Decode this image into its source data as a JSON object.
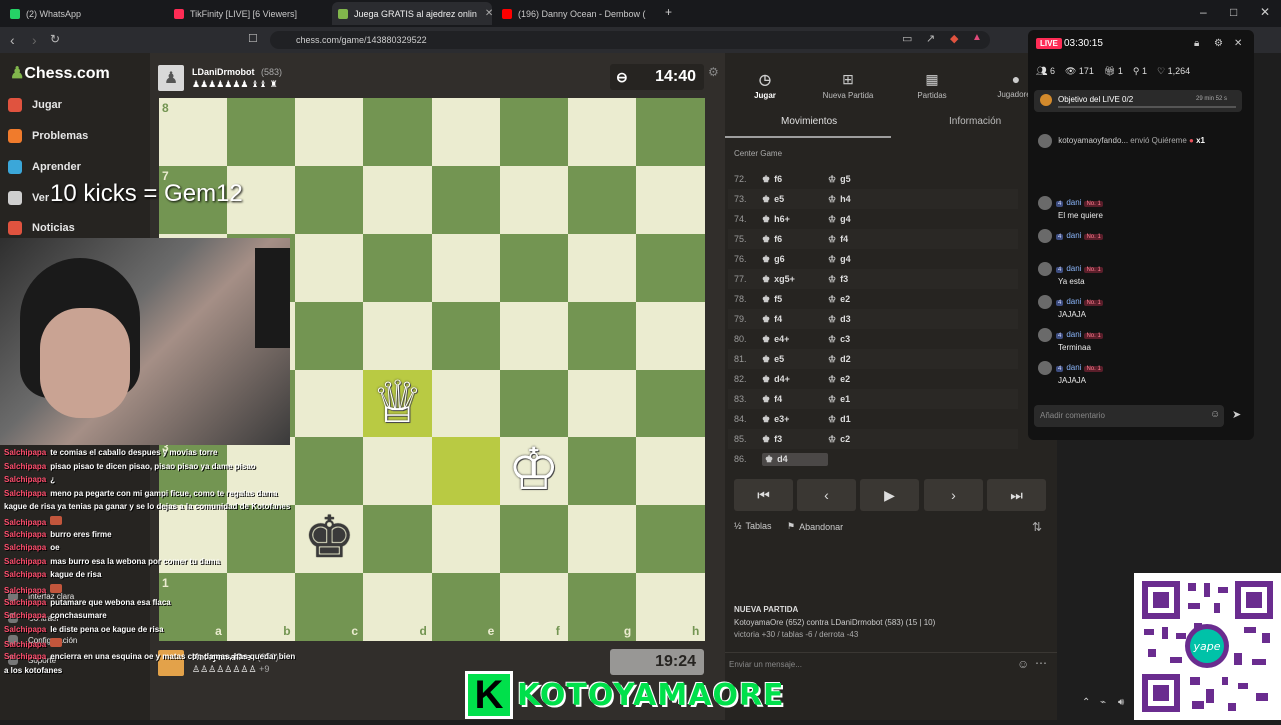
{
  "browser": {
    "tabs": [
      {
        "label": "(2) WhatsApp",
        "color": "#25d366"
      },
      {
        "label": "TikFinity [LIVE] [6 Viewers]",
        "color": "#fe2c55"
      },
      {
        "label": "Juega GRATIS al ajedrez onlin",
        "color": "#81b64c"
      },
      {
        "label": "(196) Danny Ocean - Dembow (",
        "color": "#ff0000"
      }
    ],
    "url": "chess.com/game/143880329522"
  },
  "sidebar": {
    "logo": "Chess.com",
    "items": [
      {
        "label": "Jugar",
        "icon": "play-icon",
        "color": "#e0533f"
      },
      {
        "label": "Problemas",
        "icon": "puzzle-icon",
        "color": "#f07b2c"
      },
      {
        "label": "Aprender",
        "icon": "learn-icon",
        "color": "#3ba7d9"
      },
      {
        "label": "Ver",
        "icon": "binoculars-icon",
        "color": "#cfcfcf"
      },
      {
        "label": "Noticias",
        "icon": "news-icon",
        "color": "#e0533f"
      }
    ],
    "bottom": [
      "Interfaz clara",
      "Contraer",
      "Configuración",
      "Soporte"
    ]
  },
  "overlay": {
    "kicks": "10 kicks = Gem12",
    "brand_letter": "K",
    "brand_name": "KOTOYAMAORE"
  },
  "game": {
    "top_player": {
      "name": "LDaniDrmobot",
      "rating": "(583)",
      "clock": "14:40"
    },
    "bottom_player": {
      "name": "KotoyamaOre",
      "rating": "(652)",
      "clock": "19:24",
      "captures_extra": "+9"
    },
    "files": [
      "a",
      "b",
      "c",
      "d",
      "e",
      "f",
      "g",
      "h"
    ],
    "ranks_shown": [
      "8",
      "7",
      "3",
      "1"
    ]
  },
  "panel": {
    "tabs": [
      {
        "label": "Jugar",
        "icon": "clock-icon"
      },
      {
        "label": "Nueva Partida",
        "icon": "plus-icon"
      },
      {
        "label": "Partidas",
        "icon": "board-icon"
      },
      {
        "label": "Jugadores",
        "icon": "players-icon"
      }
    ],
    "subtabs": [
      "Movimientos",
      "Información"
    ],
    "opening": "Center Game",
    "moves": [
      {
        "n": "72.",
        "w": "f6",
        "b": "g5"
      },
      {
        "n": "73.",
        "w": "e5",
        "b": "h4"
      },
      {
        "n": "74.",
        "w": "h6+",
        "b": "g4"
      },
      {
        "n": "75.",
        "w": "f6",
        "b": "f4"
      },
      {
        "n": "76.",
        "w": "g6",
        "b": "g4"
      },
      {
        "n": "77.",
        "w": "xg5+",
        "b": "f3"
      },
      {
        "n": "78.",
        "w": "f5",
        "b": "e2"
      },
      {
        "n": "79.",
        "w": "f4",
        "b": "d3"
      },
      {
        "n": "80.",
        "w": "e4+",
        "b": "c3"
      },
      {
        "n": "81.",
        "w": "e5",
        "b": "d2"
      },
      {
        "n": "82.",
        "w": "d4+",
        "b": "e2"
      },
      {
        "n": "83.",
        "w": "f4",
        "b": "e1"
      },
      {
        "n": "84.",
        "w": "e3+",
        "b": "d1"
      },
      {
        "n": "85.",
        "w": "f3",
        "b": "c2"
      },
      {
        "n": "86.",
        "w": "d4",
        "b": ""
      }
    ],
    "draw_label": "Tablas",
    "resign_label": "Abandonar",
    "new_game_title": "NUEVA PARTIDA",
    "new_game_line": "KotoyamaOre (652) contra LDaniDrmobot (583) (15 | 10)",
    "new_game_stats": "victoria +30 / tablas -6 / derrota -43",
    "message_placeholder": "Enviar un mensaje..."
  },
  "tiktok": {
    "live": "LIVE",
    "timer": "03:30:15",
    "stats": [
      "6",
      "171",
      "1",
      "1",
      "1,264"
    ],
    "goal_label": "Objetivo del LIVE 0/2",
    "goal_time": "29 min 52 s",
    "gift": {
      "user": "kotoyamaoyfando...",
      "text": "envió Quiéreme",
      "count": "x1"
    },
    "comments": [
      {
        "user": "dani",
        "text": "El me quiere"
      },
      {
        "user": "dani",
        "text": ""
      },
      {
        "user": "dani",
        "text": "Ya esta"
      },
      {
        "user": "dani",
        "text": "JAJAJA"
      },
      {
        "user": "dani",
        "text": "Terminaa"
      },
      {
        "user": "dani",
        "text": "JAJAJA"
      }
    ],
    "level_badge": "4",
    "rank_badge": "No. 1",
    "comment_placeholder": "Añadir comentario"
  },
  "stream_chat": [
    {
      "user": "Salchipapa",
      "text": "te comias el caballo despues y movias torre"
    },
    {
      "user": "Salchipapa",
      "text": "pisao pisao te dicen pisao, pisao pisao ya dame pisao"
    },
    {
      "user": "Salchipapa",
      "text": "¿"
    },
    {
      "user": "Salchipapa",
      "text": "meno pa pegarte con mi gampi ficue, como te regalas dama"
    },
    {
      "user": "",
      "text": "kague de risa ya tenias pa ganar y se lo dejas a la comunidad de Kotofanes"
    },
    {
      "user": "Salchipapa",
      "text": ""
    },
    {
      "user": "Salchipapa",
      "text": "burro eres firme"
    },
    {
      "user": "Salchipapa",
      "text": "oe"
    },
    {
      "user": "Salchipapa",
      "text": "mas burro esa la webona por comer tu dama"
    },
    {
      "user": "Salchipapa",
      "text": "kague de risa"
    },
    {
      "user": "Salchipapa",
      "text": ""
    },
    {
      "user": "Salchipapa",
      "text": "putamare que webona esa flaca"
    },
    {
      "user": "Salchipapa",
      "text": "conchasumare"
    },
    {
      "user": "Salchipapa",
      "text": "le diste pena oe kague de risa"
    },
    {
      "user": "Salchipapa",
      "text": ""
    },
    {
      "user": "Salchipapa",
      "text": "encierra en una esquina oe y matas con damas, has quedar bien"
    },
    {
      "user": "",
      "text": "a los kotofanes"
    }
  ],
  "colors": {
    "light_square": "#ebecd0",
    "dark_square": "#739552",
    "highlight": "#b9ca43",
    "accent": "#81b64c"
  }
}
